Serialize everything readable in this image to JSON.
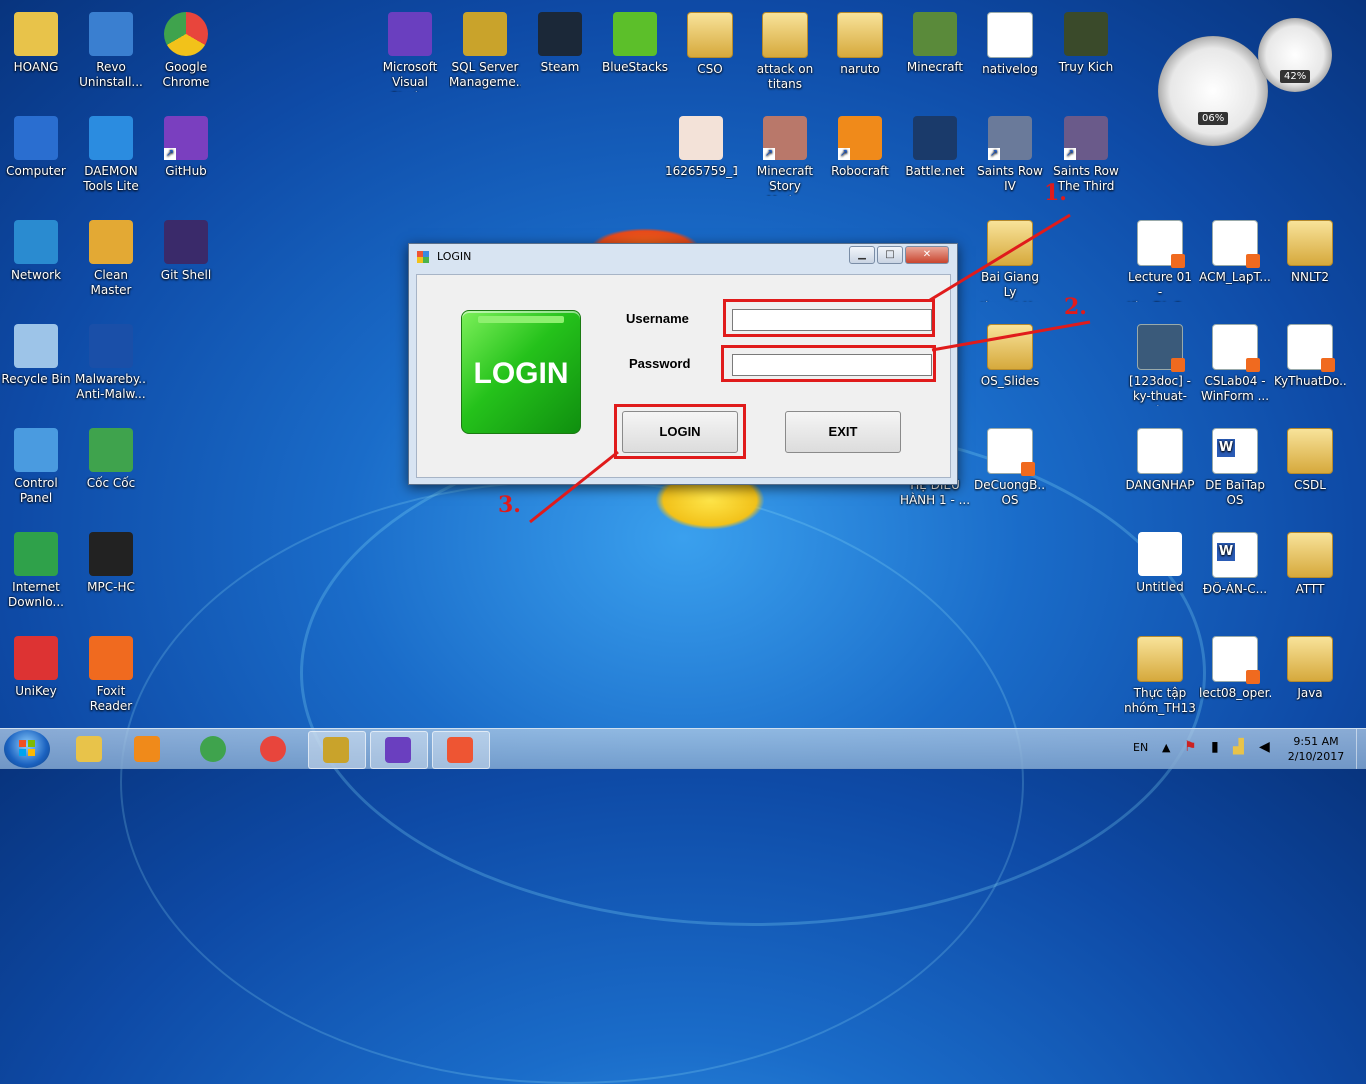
{
  "desktop": {
    "icons": [
      {
        "label": "HOANG",
        "type": "user",
        "color": "#e8c34a"
      },
      {
        "label": "Revo\nUninstall...",
        "type": "app",
        "color": "#3a7fd0"
      },
      {
        "label": "Google\nChrome",
        "type": "chrome",
        "color": "#e8453c"
      },
      {
        "label": "Computer",
        "type": "computer",
        "color": "#2a6ed0"
      },
      {
        "label": "DAEMON\nTools Lite",
        "type": "app",
        "color": "#2b8ce0"
      },
      {
        "label": "GitHub",
        "type": "shortcut",
        "color": "#7a3fbf"
      },
      {
        "label": "Network",
        "type": "network",
        "color": "#2a8bd0"
      },
      {
        "label": "Clean Master",
        "type": "app",
        "color": "#e3a934"
      },
      {
        "label": "Git Shell",
        "type": "app",
        "color": "#3a2a6a"
      },
      {
        "label": "Recycle Bin",
        "type": "bin",
        "color": "#9dc4e8"
      },
      {
        "label": "Malwareby...\nAnti-Malw...",
        "type": "app",
        "color": "#1a4fa8"
      },
      {
        "label": "Control\nPanel",
        "type": "app",
        "color": "#4a9be0"
      },
      {
        "label": "Cốc Cốc",
        "type": "app",
        "color": "#3fa34d"
      },
      {
        "label": "Internet\nDownlo...",
        "type": "app",
        "color": "#2fa14a"
      },
      {
        "label": "MPC-HC",
        "type": "app",
        "color": "#222222"
      },
      {
        "label": "UniKey",
        "type": "app",
        "color": "#d33"
      },
      {
        "label": "Foxit Reader",
        "type": "app",
        "color": "#f06a1f"
      },
      {
        "label": "Microsoft\nVisual Stud...",
        "type": "app",
        "color": "#6a3fbf"
      },
      {
        "label": "SQL Server\nManageme...",
        "type": "app",
        "color": "#c9a32b"
      },
      {
        "label": "Steam",
        "type": "app",
        "color": "#1b2838"
      },
      {
        "label": "BlueStacks",
        "type": "app",
        "color": "#5cbf2a"
      },
      {
        "label": "CSO",
        "type": "folder",
        "color": "#e8c34a"
      },
      {
        "label": "attack on\ntitans",
        "type": "folder",
        "color": "#e8c34a"
      },
      {
        "label": "naruto",
        "type": "folder",
        "color": "#e8c34a"
      },
      {
        "label": "Minecraft",
        "type": "app",
        "color": "#5a8a3a"
      },
      {
        "label": "nativelog",
        "type": "doc",
        "color": "#ffffff"
      },
      {
        "label": "Truy Kich",
        "type": "app",
        "color": "#3a4a2a"
      },
      {
        "label": "16265759_1...",
        "type": "image",
        "color": "#f3e2d8"
      },
      {
        "label": "Minecraft\nStory Mod...",
        "type": "shortcut",
        "color": "#b9786a"
      },
      {
        "label": "Robocraft",
        "type": "shortcut",
        "color": "#f08a1a"
      },
      {
        "label": "Battle.net",
        "type": "app",
        "color": "#1a3a6a"
      },
      {
        "label": "Saints Row IV",
        "type": "shortcut",
        "color": "#6a7a9a"
      },
      {
        "label": "Saints Row\nThe Third",
        "type": "shortcut",
        "color": "#6a5a8a"
      },
      {
        "label": "Bai Giang Ly\nthuyet He ...",
        "type": "folder",
        "color": "#e8c34a"
      },
      {
        "label": "OS_Slides",
        "type": "folder",
        "color": "#e8c34a"
      },
      {
        "label": "DeCuongB...\nOS",
        "type": "pdf",
        "color": "#ffffff"
      },
      {
        "label": "Lecture 01 -\nKieuDL C...",
        "type": "pdf",
        "color": "#ffffff"
      },
      {
        "label": "ACM_LapT...",
        "type": "pdf",
        "color": "#ffffff"
      },
      {
        "label": "NNLT2",
        "type": "folder",
        "color": "#e8c34a"
      },
      {
        "label": "[123doc] -\nky-thuat-vi...",
        "type": "pdf",
        "color": "#3a5a7a"
      },
      {
        "label": "CSLab04 -\nWinForm ...",
        "type": "pdf",
        "color": "#ffffff"
      },
      {
        "label": "KyThuatDo...",
        "type": "pdf",
        "color": "#ffffff"
      },
      {
        "label": "DANGNHAP",
        "type": "doc",
        "color": "#ffffff"
      },
      {
        "label": "DE BaiTap OS",
        "type": "word",
        "color": "#ffffff"
      },
      {
        "label": "CSDL",
        "type": "folder",
        "color": "#e8c34a"
      },
      {
        "label": "Untitled",
        "type": "image",
        "color": "#ffffff"
      },
      {
        "label": "ĐỒ-ÁN-C...",
        "type": "word",
        "color": "#ffffff"
      },
      {
        "label": "ATTT",
        "type": "folder",
        "color": "#e8c34a"
      },
      {
        "label": "Thực tập\nnhóm_TH13",
        "type": "folder",
        "color": "#e8c34a"
      },
      {
        "label": "lect08_oper...",
        "type": "pdf",
        "color": "#ffffff"
      },
      {
        "label": "Java",
        "type": "folder",
        "color": "#e8c34a"
      },
      {
        "label": "HỆ ĐIỀU\nHÀNH 1 - ...",
        "type": "doc",
        "color": "#ffffff"
      }
    ]
  },
  "gadget": {
    "cpu": "06%",
    "mem": "42%"
  },
  "dialog": {
    "title": "LOGIN",
    "logo_text": "LOGIN",
    "username_label": "Username",
    "password_label": "Password",
    "username_value": "",
    "password_value": "",
    "login_button": "LOGIN",
    "exit_button": "EXIT",
    "minimize": "▁",
    "maximize": "□",
    "close": "✕"
  },
  "annotations": {
    "step1": "1.",
    "step2": "2.",
    "step3": "3.",
    "color": "#e01b1b"
  },
  "taskbar": {
    "apps": [
      {
        "name": "explorer",
        "color": "#e8c34a"
      },
      {
        "name": "media-player",
        "color": "#f08a1a"
      },
      {
        "name": "coc-coc",
        "color": "#3fa34d"
      },
      {
        "name": "chrome",
        "color": "#e8453c"
      },
      {
        "name": "sql-server",
        "color": "#c9a32b"
      },
      {
        "name": "visual-studio",
        "color": "#6a3fbf"
      },
      {
        "name": "login-app",
        "color": "#e53"
      }
    ],
    "language": "EN",
    "time": "9:51 AM",
    "date": "2/10/2017"
  }
}
